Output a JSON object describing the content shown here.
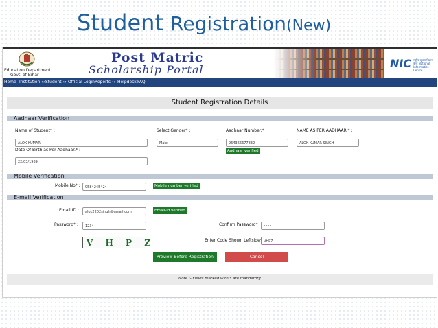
{
  "slide": {
    "title_part1": "Student ",
    "title_part2": "Registration",
    "title_part3": "(New)",
    "title_color": "#1f5f9c"
  },
  "portal": {
    "dept_line1": "Education Department",
    "dept_line2": "Govt. of Bihar",
    "title": "Post Matric",
    "subtitle": "Scholarship Portal",
    "nic_logo": "NIC",
    "nic_small": "राष्ट्रीय सूचना विज्ञान केन्द्र National Informatics Centre"
  },
  "nav": {
    "items": [
      "Home",
      "Institution ↔",
      "Student ↔",
      "Official Login",
      "Reports ↔",
      "Helpdesk",
      "FAQ"
    ],
    "bg_color": "#22457f"
  },
  "form": {
    "heading": "Student Registration Details",
    "aadhaar_section": "Aadhaar Verification",
    "name_label": "Name of Student* :",
    "name_value": "ALOK KUMAR",
    "gender_label": "Select Gender* :",
    "gender_value": "Male",
    "aadhaar_label": "Aadhaar Number.* :",
    "aadhaar_value": "964366677832",
    "aadhaar_badge": "Aadhaar verified",
    "name_aadhaar_label": "NAME AS PER AADHAAR.* :",
    "name_aadhaar_value": "ALOK KUMAR SINGH",
    "dob_label": "Date Of Birth as Per Aadhaar.* :",
    "dob_value": "22/03/1989",
    "mobile_section": "Mobile Verification",
    "mobile_label": "Mobile No* :",
    "mobile_value": "9584245424",
    "mobile_badge": "Mobile number verified",
    "email_section": "E-mail Verification",
    "email_label": "Email ID :",
    "email_value": "alok2202singh@gmail.com",
    "email_badge": "Email-Id verified",
    "password_label": "Password* :",
    "password_value": "1234",
    "confirm_label": "Confirm Password* :",
    "confirm_value": "••••",
    "code_label": "Enter Code Shown Leftside* :",
    "code_value": "VHPZ",
    "captcha_text": "V H P Z",
    "preview_button": "Preview Before Registration",
    "cancel_button": "Cancel",
    "note": "Note :- Fields marked with * are mandatory"
  },
  "colors": {
    "badge_green": "#1e7a2a",
    "cancel_red": "#d14b4b",
    "section_bar": "#bfc9d6"
  }
}
